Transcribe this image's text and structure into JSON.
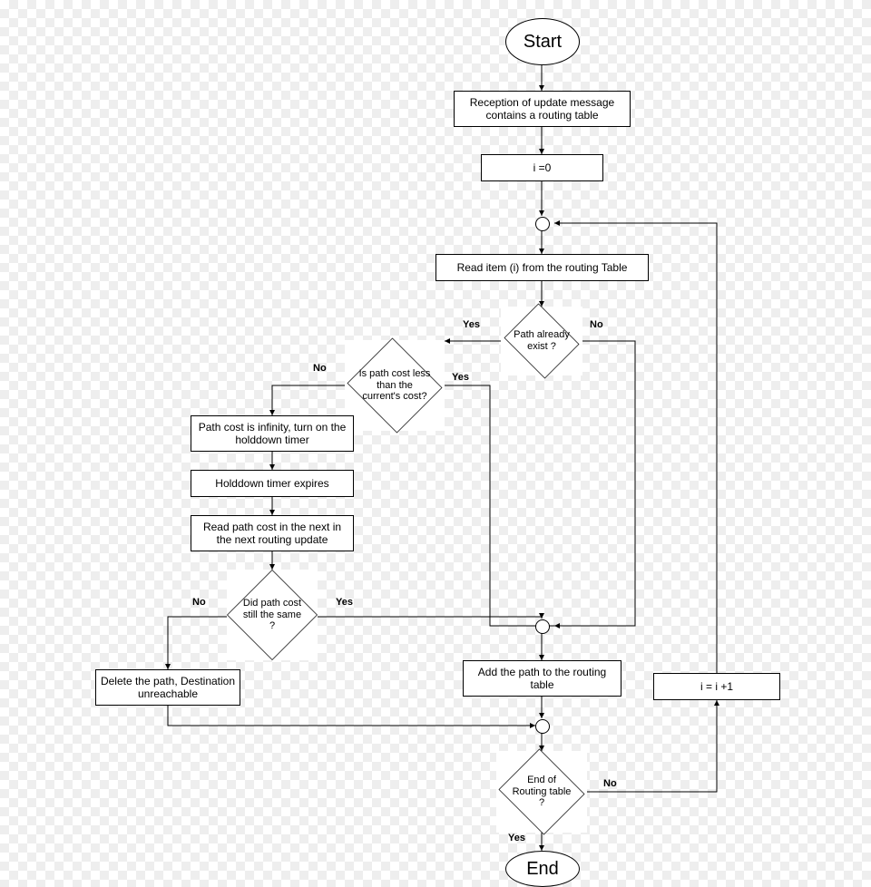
{
  "nodes": {
    "start": "Start",
    "end": "End",
    "reception": "Reception of update message contains a routing table",
    "init": "i =0",
    "read_item": "Read item (i) from the routing Table",
    "path_exist": "Path already exist ?",
    "cost_less": "Is path cost less than the current's cost?",
    "infinity": "Path cost is infinity, turn on the holddown timer",
    "expires": "Holddown timer expires",
    "read_next": "Read path cost in the next in the next routing update",
    "still_same": "Did path cost still the same ?",
    "delete": "Delete the path, Destination unreachable",
    "add": "Add the path to the routing table",
    "increment": "i = i +1",
    "end_table": "End of Routing table ?"
  },
  "labels": {
    "yes": "Yes",
    "no": "No"
  }
}
